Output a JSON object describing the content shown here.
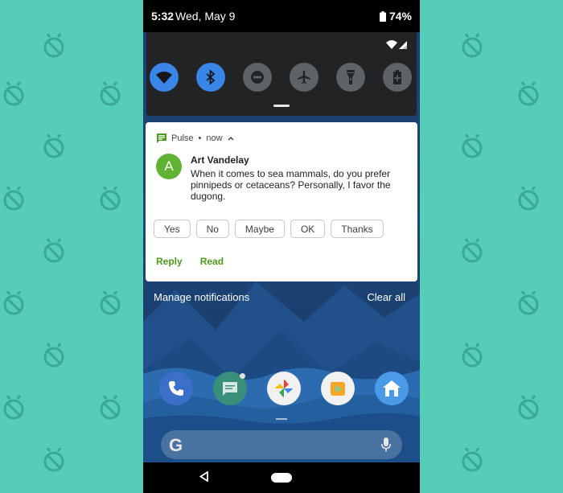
{
  "status_bar": {
    "time": "5:32",
    "date": "Wed, May 9",
    "battery": "74%"
  },
  "quick_settings": {
    "tiles": [
      {
        "icon": "wifi-icon",
        "active": true
      },
      {
        "icon": "bluetooth-icon",
        "active": true
      },
      {
        "icon": "do-not-disturb-icon",
        "active": false
      },
      {
        "icon": "airplane-icon",
        "active": false
      },
      {
        "icon": "flashlight-icon",
        "active": false
      },
      {
        "icon": "battery-saver-icon",
        "active": false
      }
    ]
  },
  "notification": {
    "app_name": "Pulse",
    "time": "now",
    "avatar_letter": "A",
    "avatar_color": "#5fb333",
    "sender": "Art Vandelay",
    "message": "When it comes to sea mammals, do you prefer pinnipeds or cetaceans? Personally, I favor the dugong.",
    "smart_replies": [
      "Yes",
      "No",
      "Maybe",
      "OK",
      "Thanks"
    ],
    "actions": [
      "Reply",
      "Read"
    ],
    "accent_color": "#4e9a1c"
  },
  "shade_footer": {
    "manage": "Manage notifications",
    "clear": "Clear all"
  },
  "dock": [
    "phone-icon",
    "messages-icon",
    "photos-icon",
    "play-store-icon",
    "home-app-icon"
  ],
  "search": {
    "logo": "G",
    "mic": "mic-icon"
  },
  "colors": {
    "background": "#56cdb9",
    "quick_settings_active": "#3a86e8"
  }
}
